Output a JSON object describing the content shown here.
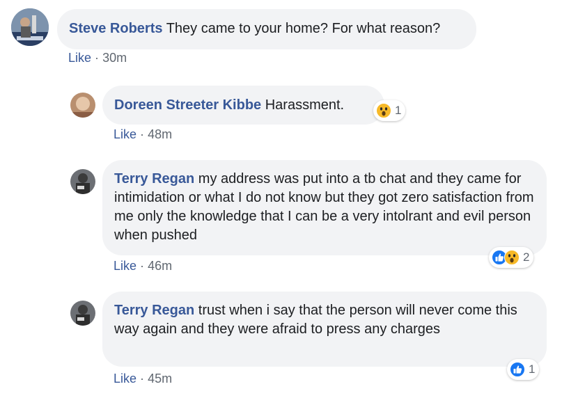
{
  "comments": [
    {
      "author": "Steve Roberts",
      "text": "They came to your home? For what reason?",
      "like_label": "Like",
      "separator": "·",
      "time": "30m"
    },
    {
      "author": "Doreen Streeter Kibbe",
      "text": "Harassment.",
      "like_label": "Like",
      "separator": "·",
      "time": "48m",
      "reactions": {
        "icons": [
          "wow-icon"
        ],
        "count": "1"
      }
    },
    {
      "author": "Terry Regan",
      "text": "my address was put into a tb chat and they came for intimidation or what I do not know but they got zero satisfaction from me only the knowledge that I can be a very intolrant and evil person when pushed",
      "like_label": "Like",
      "separator": "·",
      "time": "46m",
      "reactions": {
        "icons": [
          "like-icon",
          "wow-icon"
        ],
        "count": "2"
      }
    },
    {
      "author": "Terry Regan",
      "text": "trust when i say that the person will never come this way again and they were afraid to press any charges",
      "like_label": "Like",
      "separator": "·",
      "time": "45m",
      "reactions": {
        "icons": [
          "like-icon"
        ],
        "count": "1"
      }
    }
  ],
  "colors": {
    "author": "#385898",
    "bubble": "#f2f3f5",
    "text": "#1c1e21",
    "meta": "#606770",
    "like_reaction": "#1877f2",
    "wow_reaction": "#f7b928"
  }
}
